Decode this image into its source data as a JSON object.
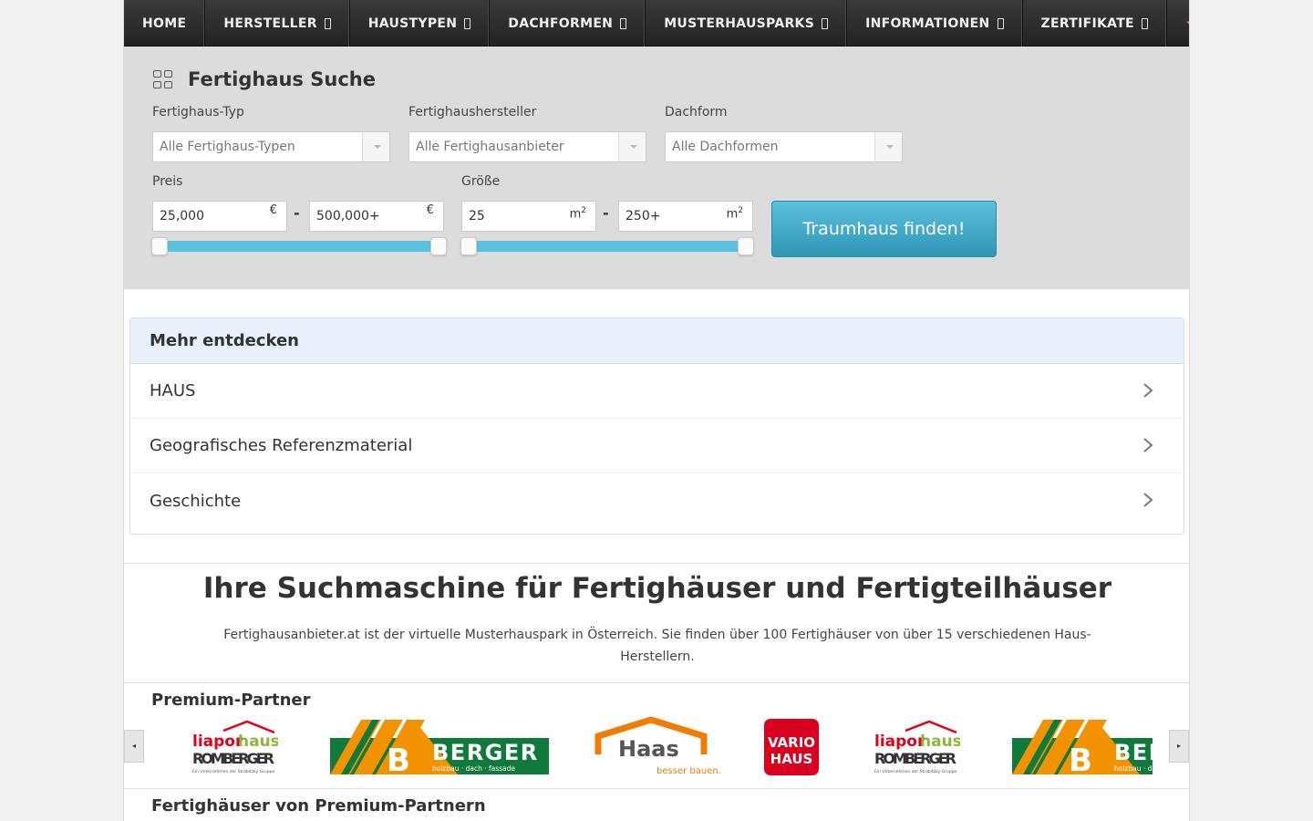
{
  "nav": {
    "items": [
      {
        "label": "HOME",
        "dropdown": false
      },
      {
        "label": "HERSTELLER",
        "dropdown": true
      },
      {
        "label": "HAUSTYPEN",
        "dropdown": true
      },
      {
        "label": "DACHFORMEN",
        "dropdown": true
      },
      {
        "label": "MUSTERHAUSPARKS",
        "dropdown": true
      },
      {
        "label": "INFORMATIONEN",
        "dropdown": true
      },
      {
        "label": "ZERTIFIKATE",
        "dropdown": true
      }
    ],
    "favorite_icon": "star-icon",
    "accent": "#f5a623"
  },
  "search": {
    "title": "Fertighaus Suche",
    "type_label": "Fertighaus-Typ",
    "type_value": "Alle Fertighaus-Typen",
    "maker_label": "Fertighaushersteller",
    "maker_value": "Alle Fertighausanbieter",
    "roof_label": "Dachform",
    "roof_value": "Alle Dachformen",
    "price_label": "Preis",
    "price_min": "25,000",
    "price_max": "500,000+",
    "price_unit": "€",
    "size_label": "Größe",
    "size_min": "25",
    "size_max": "250+",
    "size_unit": "m",
    "size_unit_exp": "2",
    "dash": "-",
    "button_label": "Traumhaus finden!",
    "button_color": "#5bc0de"
  },
  "discover": {
    "title": "Mehr entdecken",
    "items": [
      "HAUS",
      "Geografisches Referenzmaterial",
      "Geschichte"
    ]
  },
  "hero": {
    "title": "Ihre Suchmaschine für Fertighäuser und Fertigteilhäuser",
    "text": "Fertighausanbieter.at ist der virtuelle Musterhauspark in Österreich. Sie finden über 100 Fertighäuser von über 15 verschiedenen Haus-Herstellern."
  },
  "partners": {
    "title": "Premium-Partner",
    "prev": "◂",
    "next": "▸",
    "logo_texts": {
      "liapor_top": "liapor",
      "liapor_haus": "haus",
      "liapor_name": "ROMBERGER",
      "liapor_sub": "Ein Unternehmen der Strabitzky Gruppe",
      "berger_name": "BERGER",
      "berger_sub": "holzbau · dach · fassade",
      "haas_name": "Haas",
      "haas_sub": "besser bauen.",
      "vario_line1": "VARIO",
      "vario_line2": "HAUS"
    }
  },
  "premium_houses": {
    "title": "Fertighäuser von Premium-Partnern"
  }
}
